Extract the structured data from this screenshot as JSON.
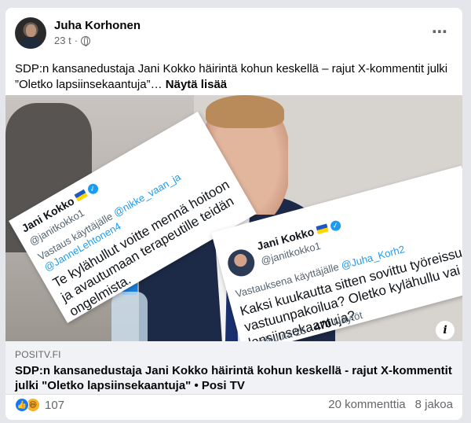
{
  "post": {
    "author": "Juha Korhonen",
    "time": "23 t",
    "separator": "·",
    "text": "SDP:n kansanedustaja Jani Kokko häirintä kohun keskellä – rajut X-kommentit julki ”Oletko lapsiinsekaantuja”…",
    "see_more": "Näytä lisää",
    "more_icon": "⋯"
  },
  "tweet_left": {
    "name": "Jani Kokko",
    "handle": "@janitkokko1",
    "reply_prefix": "Vastaus käyttäjälle",
    "reply_to_1": "@nikke_vaan_ja",
    "reply_to_2": "@JanneLehtonen4",
    "body": "Te kylähullut voitte mennä hoitoon ja avautumaan terapeutille teidän ongelmista."
  },
  "tweet_right": {
    "name": "Jani Kokko",
    "handle": "@janitkokko1",
    "reply_prefix": "Vastauksena käyttäjälle",
    "reply_to": "@Juha_Korh2",
    "body": "Kaksi kuukautta sitten sovittu työreissu vastuunpakoilua? Oletko kylähullu vai lapsiinsekaantuja?",
    "date": "mmikuuta 26 ·",
    "views_count": "470",
    "views_label": "Näytöt"
  },
  "link": {
    "domain": "POSITV.FI",
    "title": "SDP:n kansanedustaja Jani Kokko häirintä kohun keskellä - rajut X-kommentit julki \"Oletko lapsiinsekaantuja\" • Posi TV",
    "info_icon": "i"
  },
  "stats": {
    "reaction_count": "107",
    "comments": "20 kommenttia",
    "shares": "8 jakoa"
  },
  "colors": {
    "link_blue": "#1d9bf0",
    "fb_blue": "#1877f2",
    "background": "#e4e6eb"
  }
}
